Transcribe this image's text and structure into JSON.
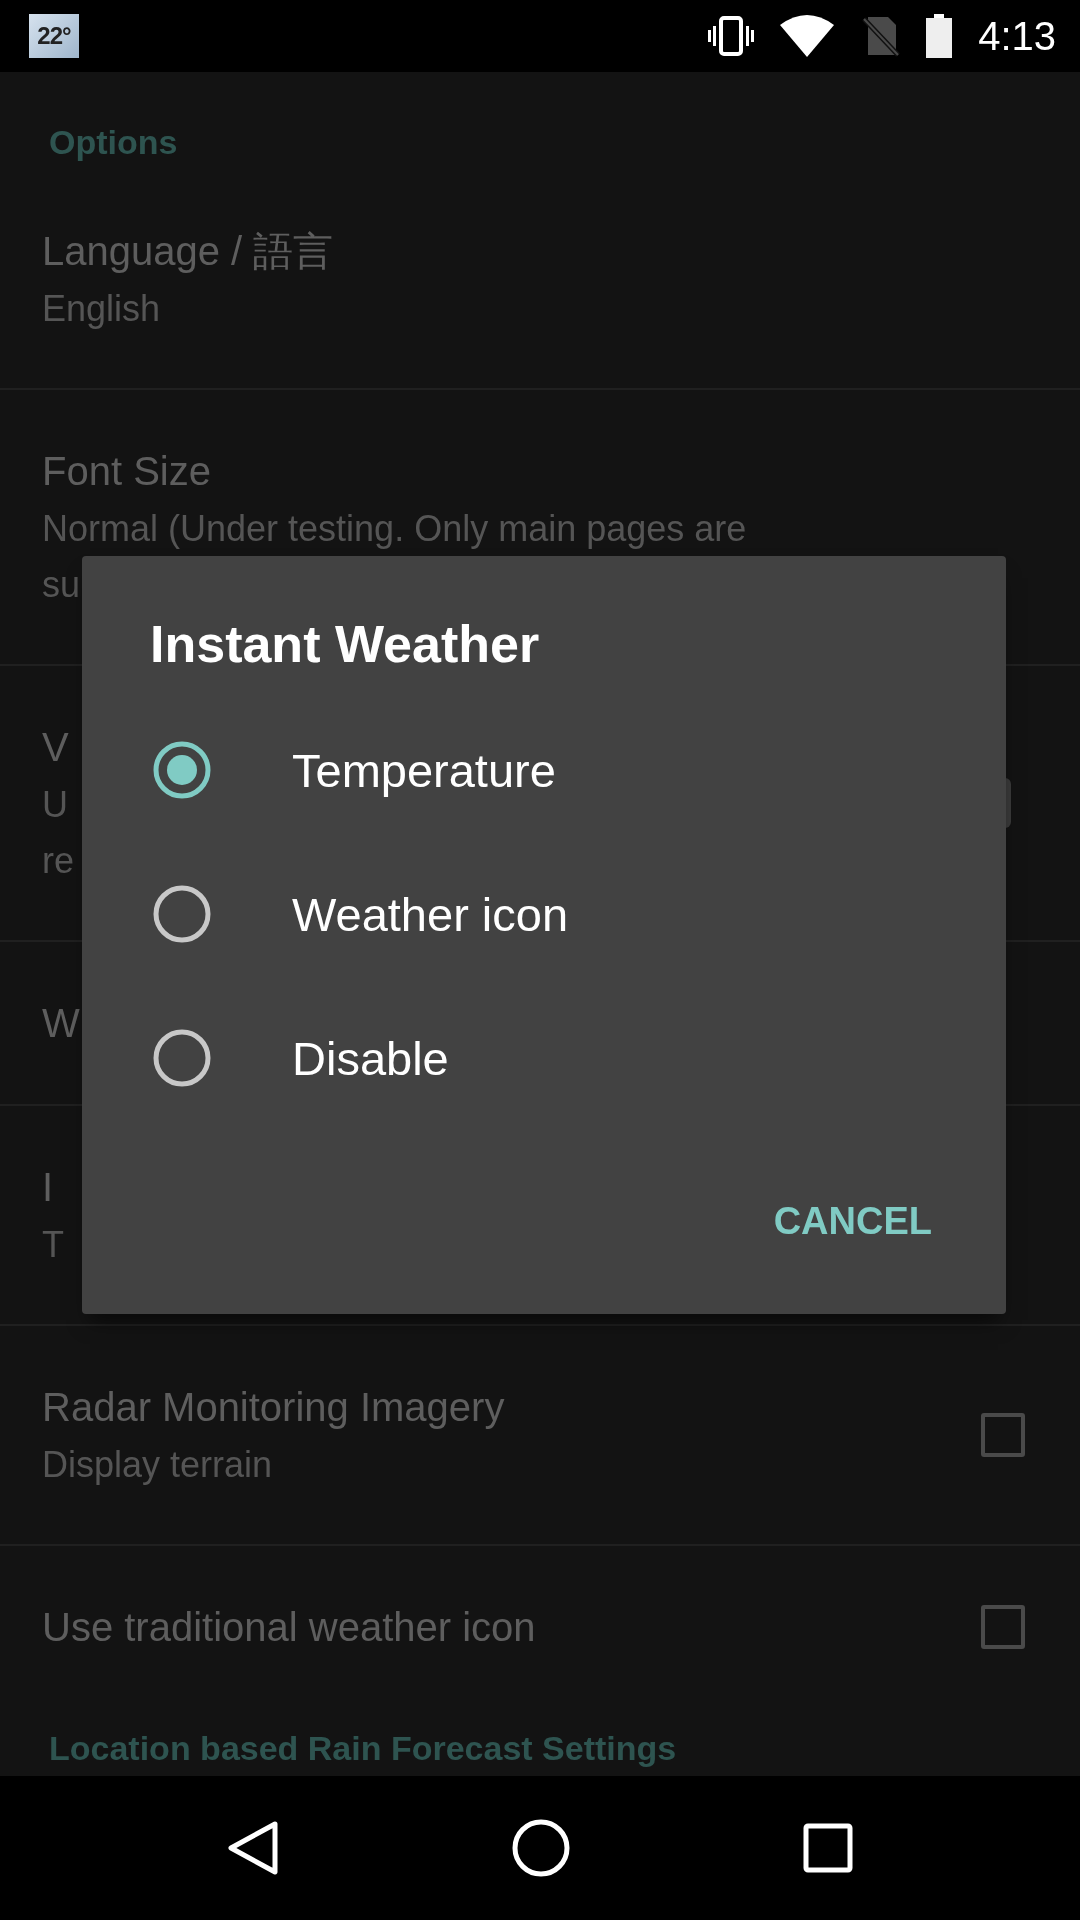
{
  "status_bar": {
    "notification_text": "22°",
    "time": "4:13"
  },
  "settings": {
    "header": "Options",
    "items": [
      {
        "kind": "text",
        "title": "Language / 語言",
        "subtitle_lines": [
          "English"
        ]
      },
      {
        "kind": "text",
        "title": "Font Size",
        "subtitle_lines": [
          "Normal (Under testing. Only main pages are",
          "su"
        ]
      },
      {
        "kind": "switch",
        "title": "V",
        "subtitle_lines": [
          "U",
          "re"
        ]
      },
      {
        "kind": "text",
        "title": "W"
      },
      {
        "kind": "text",
        "title": "I",
        "subtitle_lines": [
          "T"
        ]
      },
      {
        "kind": "checkbox",
        "title": "Radar Monitoring Imagery",
        "subtitle_lines": [
          "Display terrain"
        ],
        "checked": false
      },
      {
        "kind": "checkbox",
        "title": "Use traditional weather icon",
        "checked": false
      }
    ],
    "footer_header": "Location based Rain Forecast Settings"
  },
  "dialog": {
    "title": "Instant Weather",
    "options": [
      {
        "label": "Temperature",
        "selected": true
      },
      {
        "label": "Weather icon",
        "selected": false
      },
      {
        "label": "Disable",
        "selected": false
      }
    ],
    "button": "CANCEL"
  }
}
